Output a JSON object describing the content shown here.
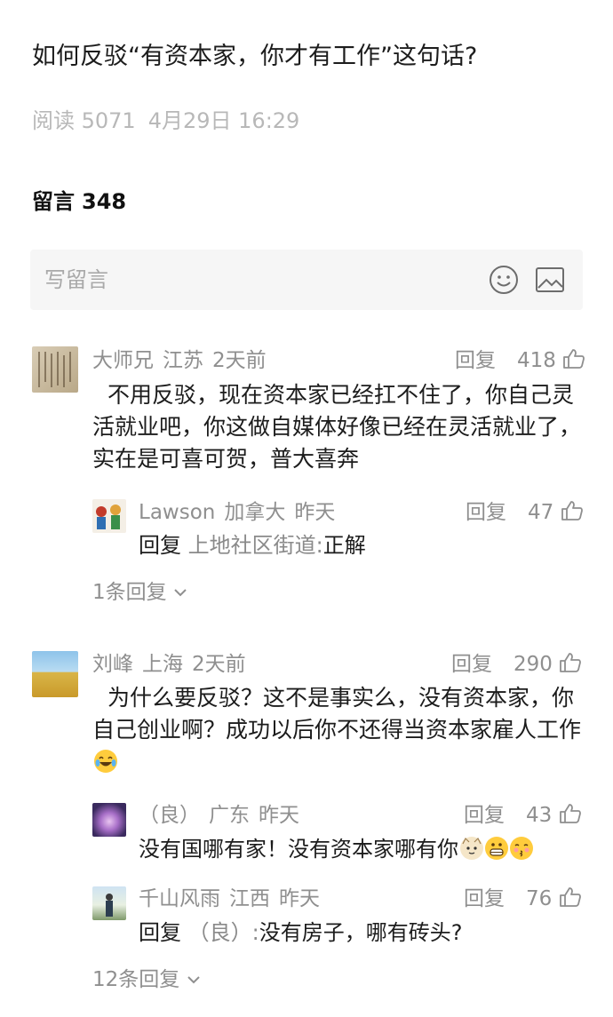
{
  "article": {
    "title": "如何反驳“有资本家，你才有工作”这句话?",
    "reads_label": "阅读 5071",
    "date": "4月29日 16:29"
  },
  "comments_header": {
    "label": "留言",
    "count": "348"
  },
  "composer": {
    "placeholder": "写留言",
    "emoji_icon": "smiley-icon",
    "image_icon": "image-icon"
  },
  "comments": [
    {
      "user": "大师兄",
      "location": "江苏",
      "time": "2天前",
      "reply_label": "回复",
      "likes": "418",
      "text": "不用反驳，现在资本家已经扛不住了，你自己灵活就业吧，你这做自媒体好像已经在灵活就业了，实在是可喜可贺，普大喜奔",
      "replies": [
        {
          "user": "Lawson",
          "location": "加拿大",
          "time": "昨天",
          "reply_label": "回复",
          "likes": "47",
          "prefix": "回复",
          "target": "上地社区街道:",
          "text": "正解"
        }
      ],
      "more_replies": "1条回复"
    },
    {
      "user": "刘峰",
      "location": "上海",
      "time": "2天前",
      "reply_label": "回复",
      "likes": "290",
      "text": "为什么要反驳？这不是事实么，没有资本家，你自己创业啊？成功以后你不还得当资本家雇人工作",
      "emoji": "laughing-tears-emoji",
      "replies": [
        {
          "user": "（良）",
          "location": "广东",
          "time": "昨天",
          "reply_label": "回复",
          "likes": "43",
          "text": "没有国哪有家！没有资本家哪有你",
          "emojis": [
            "cat-face-emoji",
            "grinning-emoji",
            "kissing-emoji"
          ]
        },
        {
          "user": "千山风雨",
          "location": "江西",
          "time": "昨天",
          "reply_label": "回复",
          "likes": "76",
          "prefix": "回复",
          "target": "（良）:",
          "text": "没有房子，哪有砖头?"
        }
      ],
      "more_replies": "12条回复"
    }
  ]
}
